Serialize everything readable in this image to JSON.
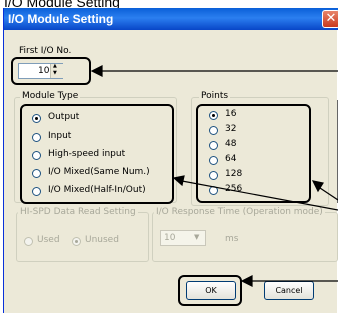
{
  "page_caption": "I/O Module Setting",
  "window": {
    "title": "I/O Module Setting",
    "close_glyph": "✕"
  },
  "first_io": {
    "label": "First I/O No.",
    "value": "10",
    "spin_up": "▲",
    "spin_down": "▼"
  },
  "module_type": {
    "legend": "Module Type",
    "options": [
      {
        "label": "Output",
        "selected": true
      },
      {
        "label": "Input",
        "selected": false
      },
      {
        "label": "High-speed input",
        "selected": false
      },
      {
        "label": "I/O Mixed(Same Num.)",
        "selected": false
      },
      {
        "label": "I/O Mixed(Half-In/Out)",
        "selected": false
      }
    ]
  },
  "points": {
    "legend": "Points",
    "options": [
      {
        "label": "16",
        "selected": true
      },
      {
        "label": "32",
        "selected": false
      },
      {
        "label": "48",
        "selected": false
      },
      {
        "label": "64",
        "selected": false
      },
      {
        "label": "128",
        "selected": false
      },
      {
        "label": "256",
        "selected": false
      }
    ]
  },
  "hispd": {
    "legend": "HI-SPD Data Read Setting",
    "used_label": "Used",
    "unused_label": "Unused",
    "selected": "Unused"
  },
  "response_time": {
    "legend": "I/O Response Time (Operation mode)",
    "value": "10",
    "unit": "ms",
    "dropdown_glyph": "▼"
  },
  "buttons": {
    "ok": "OK",
    "cancel": "Cancel"
  },
  "colors": {
    "titlebar": "#0a5fd8",
    "dialog_bg": "#ece9d8",
    "annotation": "#000000"
  }
}
